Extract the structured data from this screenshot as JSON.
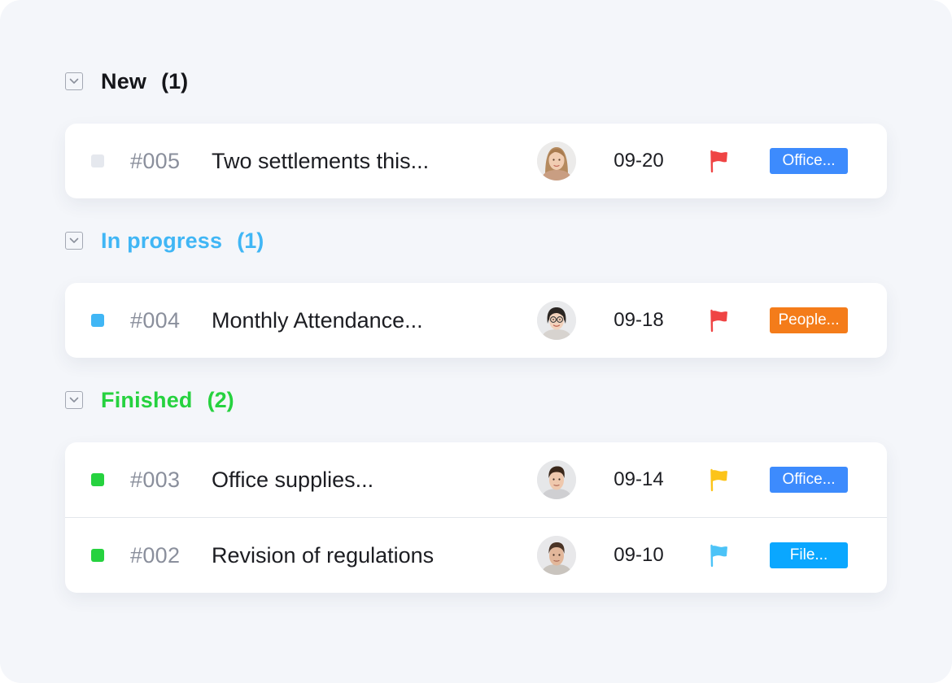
{
  "colors": {
    "new": "#15161a",
    "in_progress": "#40b6f5",
    "finished": "#26d23f",
    "dot_new": "#e5e8ee",
    "flag_red": "#ef4444",
    "flag_yellow": "#fcc419",
    "flag_blue": "#4cc3f7",
    "tag_blue": "#3d8bfd",
    "tag_orange": "#f47c1a",
    "tag_cyan": "#0aa7ff"
  },
  "groups": [
    {
      "title": "New",
      "count": "(1)",
      "tasks": [
        {
          "id": "#005",
          "title": "Two settlements this...",
          "assignee_icon": "avatar-woman-icon",
          "date": "09-20",
          "priority_icon": "red-flag-icon",
          "tag": "Office..."
        }
      ]
    },
    {
      "title": "In progress",
      "count": "(1)",
      "tasks": [
        {
          "id": "#004",
          "title": "Monthly Attendance...",
          "assignee_icon": "avatar-woman-glasses-icon",
          "date": "09-18",
          "priority_icon": "red-flag-icon",
          "tag": "People..."
        }
      ]
    },
    {
      "title": "Finished",
      "count": "(2)",
      "tasks": [
        {
          "id": "#003",
          "title": "Office supplies...",
          "assignee_icon": "avatar-man-icon",
          "date": "09-14",
          "priority_icon": "yellow-flag-icon",
          "tag": "Office..."
        },
        {
          "id": "#002",
          "title": "Revision of regulations",
          "assignee_icon": "avatar-man-icon",
          "date": "09-10",
          "priority_icon": "blue-flag-icon",
          "tag": "File..."
        }
      ]
    }
  ]
}
